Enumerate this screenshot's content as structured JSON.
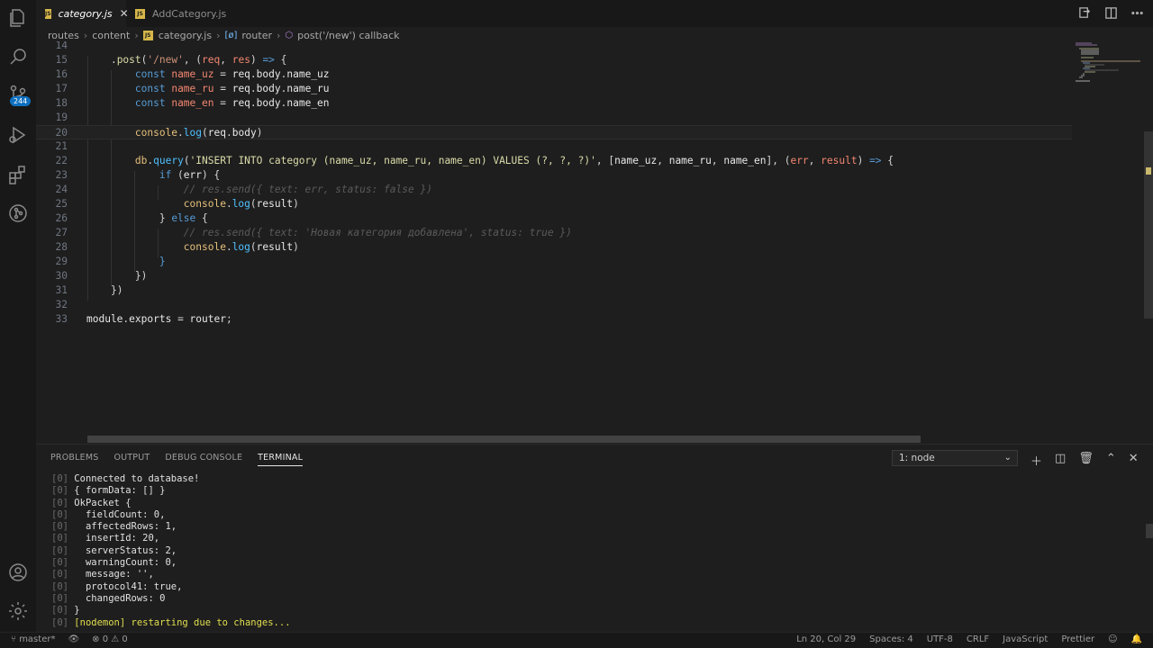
{
  "tabs": [
    {
      "label": "category.js",
      "icon": "JS",
      "active": true
    },
    {
      "label": "AddCategory.js",
      "icon": "JS",
      "active": false
    }
  ],
  "breadcrumb": [
    "routes",
    "content",
    "category.js",
    "router",
    "post('/new') callback"
  ],
  "editor": {
    "lines": [
      {
        "n": "14",
        "tokens": []
      },
      {
        "n": "15",
        "tokens": [
          [
            "    .",
            "t-punc"
          ],
          [
            "post",
            "t-fn"
          ],
          [
            "(",
            "t-punc"
          ],
          [
            "'/new'",
            "t-str"
          ],
          [
            ", (",
            "t-punc"
          ],
          [
            "req",
            "t-param"
          ],
          [
            ", ",
            "t-punc"
          ],
          [
            "res",
            "t-param"
          ],
          [
            ") ",
            "t-punc"
          ],
          [
            "=>",
            "t-kw"
          ],
          [
            " {",
            "t-punc"
          ]
        ]
      },
      {
        "n": "16",
        "tokens": [
          [
            "        ",
            "t-punc"
          ],
          [
            "const",
            "t-kw"
          ],
          [
            " ",
            "t-punc"
          ],
          [
            "name_uz",
            "t-param"
          ],
          [
            " = ",
            "t-punc"
          ],
          [
            "req",
            "t-ident"
          ],
          [
            ".",
            "t-punc"
          ],
          [
            "body",
            "t-ident"
          ],
          [
            ".",
            "t-punc"
          ],
          [
            "name_uz",
            "t-ident"
          ]
        ]
      },
      {
        "n": "17",
        "tokens": [
          [
            "        ",
            "t-punc"
          ],
          [
            "const",
            "t-kw"
          ],
          [
            " ",
            "t-punc"
          ],
          [
            "name_ru",
            "t-param"
          ],
          [
            " = ",
            "t-punc"
          ],
          [
            "req",
            "t-ident"
          ],
          [
            ".",
            "t-punc"
          ],
          [
            "body",
            "t-ident"
          ],
          [
            ".",
            "t-punc"
          ],
          [
            "name_ru",
            "t-ident"
          ]
        ]
      },
      {
        "n": "18",
        "tokens": [
          [
            "        ",
            "t-punc"
          ],
          [
            "const",
            "t-kw"
          ],
          [
            " ",
            "t-punc"
          ],
          [
            "name_en",
            "t-param"
          ],
          [
            " = ",
            "t-punc"
          ],
          [
            "req",
            "t-ident"
          ],
          [
            ".",
            "t-punc"
          ],
          [
            "body",
            "t-ident"
          ],
          [
            ".",
            "t-punc"
          ],
          [
            "name_en",
            "t-ident"
          ]
        ]
      },
      {
        "n": "19",
        "tokens": []
      },
      {
        "n": "20",
        "tokens": [
          [
            "        ",
            "t-punc"
          ],
          [
            "console",
            "t-yel"
          ],
          [
            ".",
            "t-punc"
          ],
          [
            "log",
            "t-method"
          ],
          [
            "(",
            "t-punc"
          ],
          [
            "req",
            "t-ident"
          ],
          [
            ".",
            "t-punc"
          ],
          [
            "body",
            "t-ident"
          ],
          [
            ")",
            "t-punc"
          ]
        ],
        "current": true
      },
      {
        "n": "21",
        "tokens": []
      },
      {
        "n": "22",
        "tokens": [
          [
            "        ",
            "t-punc"
          ],
          [
            "db",
            "t-yel"
          ],
          [
            ".",
            "t-punc"
          ],
          [
            "query",
            "t-method"
          ],
          [
            "(",
            "t-punc"
          ],
          [
            "'INSERT INTO category (name_uz, name_ru, name_en) VALUES (?, ?, ?)'",
            "t-fn"
          ],
          [
            ", [",
            "t-punc"
          ],
          [
            "name_uz",
            "t-ident"
          ],
          [
            ", ",
            "t-punc"
          ],
          [
            "name_ru",
            "t-ident"
          ],
          [
            ", ",
            "t-punc"
          ],
          [
            "name_en",
            "t-ident"
          ],
          [
            "], (",
            "t-punc"
          ],
          [
            "err",
            "t-param"
          ],
          [
            ", ",
            "t-punc"
          ],
          [
            "result",
            "t-param"
          ],
          [
            ") ",
            "t-punc"
          ],
          [
            "=>",
            "t-kw"
          ],
          [
            " {",
            "t-punc"
          ]
        ]
      },
      {
        "n": "23",
        "tokens": [
          [
            "            ",
            "t-punc"
          ],
          [
            "if",
            "t-kw"
          ],
          [
            " (",
            "t-punc"
          ],
          [
            "err",
            "t-ident"
          ],
          [
            ") {",
            "t-punc"
          ]
        ]
      },
      {
        "n": "24",
        "tokens": [
          [
            "                ",
            "t-punc"
          ],
          [
            "// res.send({ text: err, status: false })",
            "t-cmt"
          ]
        ]
      },
      {
        "n": "25",
        "tokens": [
          [
            "                ",
            "t-punc"
          ],
          [
            "console",
            "t-yel"
          ],
          [
            ".",
            "t-punc"
          ],
          [
            "log",
            "t-method"
          ],
          [
            "(",
            "t-punc"
          ],
          [
            "result",
            "t-ident"
          ],
          [
            ")",
            "t-punc"
          ]
        ]
      },
      {
        "n": "26",
        "tokens": [
          [
            "            ",
            "t-punc"
          ],
          [
            "} ",
            "t-punc"
          ],
          [
            "else",
            "t-kw"
          ],
          [
            " {",
            "t-punc"
          ]
        ]
      },
      {
        "n": "27",
        "tokens": [
          [
            "                ",
            "t-punc"
          ],
          [
            "// res.send({ text: 'Новая категория добавлена', status: true })",
            "t-cmt"
          ]
        ]
      },
      {
        "n": "28",
        "tokens": [
          [
            "                ",
            "t-punc"
          ],
          [
            "console",
            "t-yel"
          ],
          [
            ".",
            "t-punc"
          ],
          [
            "log",
            "t-method"
          ],
          [
            "(",
            "t-punc"
          ],
          [
            "result",
            "t-ident"
          ],
          [
            ")",
            "t-punc"
          ]
        ]
      },
      {
        "n": "29",
        "tokens": [
          [
            "            ",
            "t-punc"
          ],
          [
            "}",
            "t-kw"
          ]
        ]
      },
      {
        "n": "30",
        "tokens": [
          [
            "        ",
            "t-punc"
          ],
          [
            "})",
            "t-punc"
          ]
        ]
      },
      {
        "n": "31",
        "tokens": [
          [
            "    ",
            "t-punc"
          ],
          [
            "})",
            "t-punc"
          ]
        ]
      },
      {
        "n": "32",
        "tokens": []
      },
      {
        "n": "33",
        "tokens": [
          [
            "module",
            "t-ident"
          ],
          [
            ".",
            "t-punc"
          ],
          [
            "exports",
            "t-ident"
          ],
          [
            " = ",
            "t-punc"
          ],
          [
            "router",
            "t-ident"
          ],
          [
            ";",
            "t-punc"
          ]
        ]
      }
    ]
  },
  "panel": {
    "tabs": [
      "PROBLEMS",
      "OUTPUT",
      "DEBUG CONSOLE",
      "TERMINAL"
    ],
    "active_tab": "TERMINAL",
    "terminal_select": "1: node",
    "terminal_lines": [
      {
        "prefix": "[0]",
        "text": "Connected to database!"
      },
      {
        "prefix": "[0]",
        "text": "{ formData: [] }"
      },
      {
        "prefix": "[0]",
        "text": "OkPacket {"
      },
      {
        "prefix": "[0]",
        "text": "  fieldCount: 0,"
      },
      {
        "prefix": "[0]",
        "text": "  affectedRows: 1,"
      },
      {
        "prefix": "[0]",
        "text": "  insertId: 20,"
      },
      {
        "prefix": "[0]",
        "text": "  serverStatus: 2,"
      },
      {
        "prefix": "[0]",
        "text": "  warningCount: 0,"
      },
      {
        "prefix": "[0]",
        "text": "  message: '',"
      },
      {
        "prefix": "[0]",
        "text": "  protocol41: true,"
      },
      {
        "prefix": "[0]",
        "text": "  changedRows: 0"
      },
      {
        "prefix": "[0]",
        "text": "}"
      },
      {
        "prefix": "[0]",
        "text": "[nodemon] restarting due to changes...",
        "highlight": true
      }
    ]
  },
  "activity": {
    "badge": "244"
  },
  "status": {
    "branch": "master*",
    "errors": "⊗ 0 ⚠ 0",
    "right": [
      "Ln 20, Col 29",
      "Spaces: 4",
      "UTF-8",
      "CRLF",
      "JavaScript",
      "Prettier"
    ]
  }
}
